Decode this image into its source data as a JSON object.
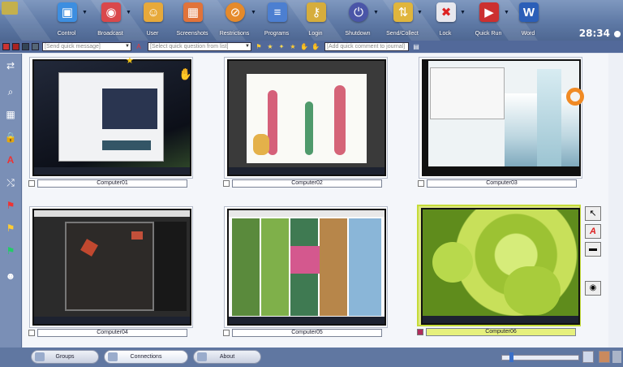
{
  "toolbar": {
    "buttons": [
      {
        "label": "Control",
        "icon": "monitor-icon"
      },
      {
        "label": "Broadcast",
        "icon": "broadcast-icon"
      },
      {
        "label": "User",
        "icon": "user-icon"
      },
      {
        "label": "Screenshots",
        "icon": "filmstrip-icon"
      },
      {
        "label": "Restrictions",
        "icon": "globe-restrict-icon"
      },
      {
        "label": "Programs",
        "icon": "programs-icon"
      },
      {
        "label": "Login",
        "icon": "key-icon"
      },
      {
        "label": "Shutdown",
        "icon": "power-icon"
      },
      {
        "label": "Send/Collect",
        "icon": "send-collect-icon"
      },
      {
        "label": "Lock",
        "icon": "mouse-lock-icon"
      },
      {
        "label": "Quick Run",
        "icon": "quick-run-icon"
      },
      {
        "label": "Word",
        "icon": "word-icon"
      }
    ],
    "clock": "28:34"
  },
  "msgbar": {
    "quick_message_placeholder": "[Send quick message]",
    "quick_question_placeholder": "[Select quick question from list]",
    "journal_comment_placeholder": "[Add quick comment to journal]"
  },
  "computers": [
    {
      "name": "Computer01"
    },
    {
      "name": "Computer02"
    },
    {
      "name": "Computer03"
    },
    {
      "name": "Computer04"
    },
    {
      "name": "Computer05"
    },
    {
      "name": "Computer06"
    }
  ],
  "bottom_tabs": {
    "groups": "Groups",
    "connections": "Connections",
    "about": "About"
  },
  "colors": {
    "toolbar": "#6f88b3",
    "selected_tile": "#c5db38"
  }
}
